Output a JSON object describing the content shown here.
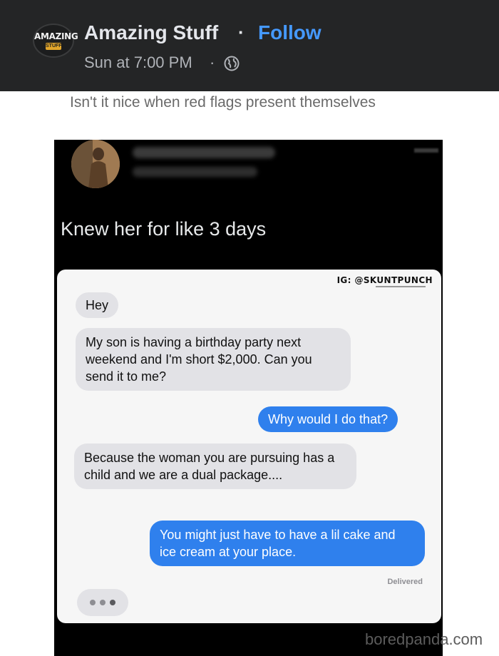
{
  "header": {
    "logo_text": "AMAZING",
    "logo_sub": "STUFF",
    "page_name": "Amazing Stuff",
    "separator": "·",
    "follow_label": "Follow",
    "timestamp": "Sun at 7:00 PM",
    "time_separator": "·",
    "audience_icon": "globe-icon",
    "background_color": "#242526",
    "follow_color": "#4599ff"
  },
  "post": {
    "caption": "Isn't it nice when red flags present themselves"
  },
  "screenshot": {
    "tweet_text": "Knew her for like 3 days",
    "watermark": "IG: @SKUNTPUNCH",
    "messages": [
      {
        "direction": "received",
        "text": "Hey"
      },
      {
        "direction": "received",
        "text": "My son is having a birthday party next weekend and I'm short $2,000. Can you send it to me?"
      },
      {
        "direction": "sent",
        "text": "Why would I do that?"
      },
      {
        "direction": "received",
        "text": "Because the woman you are pursuing has a child and we are a dual package...."
      },
      {
        "direction": "sent",
        "text": "You might just have to have a lil cake and ice cream at your place."
      }
    ],
    "delivered_label": "Delivered",
    "sent_color": "#2f80ed",
    "received_color": "#e2e2e6"
  },
  "source": "boredpanda.com"
}
